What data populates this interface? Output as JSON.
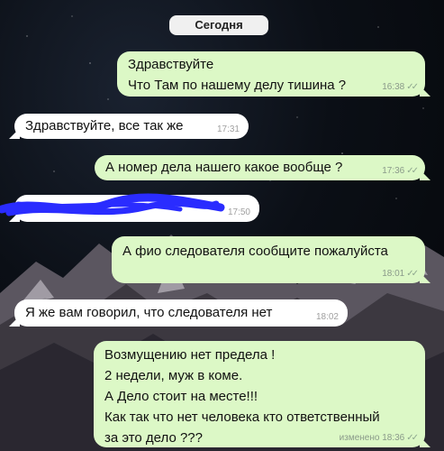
{
  "date_chip": "Сегодня",
  "messages": [
    {
      "direction": "outgoing",
      "lines": "Здравствуйте\nЧто Там по нашему делу тишина ?",
      "time": "16:38",
      "ticks": "✓✓"
    },
    {
      "direction": "incoming",
      "lines": "Здравствуйте, все так же",
      "time": "17:31"
    },
    {
      "direction": "outgoing",
      "lines": "А номер дела нашего какое вообще ?",
      "time": "17:36",
      "ticks": "✓✓"
    },
    {
      "direction": "incoming",
      "lines": "",
      "time": "17:50",
      "redacted": true
    },
    {
      "direction": "outgoing",
      "lines": "А фио следователя сообщите пожалуйста",
      "time": "18:01",
      "ticks": "✓✓"
    },
    {
      "direction": "incoming",
      "lines": "Я же вам говорил, что следователя нет",
      "time": "18:02"
    },
    {
      "direction": "outgoing",
      "lines": "Возмущению нет предела !\n2 недели, муж в коме.\nА Дело стоит на месте!!!\nКак так что нет человека кто ответственный\nза это дело ???",
      "time": "изменено 18:36",
      "ticks": "✓✓"
    }
  ],
  "colors": {
    "outgoing_bubble": "#dcf8c6",
    "incoming_bubble": "#ffffff",
    "redaction": "#2a2cff"
  }
}
